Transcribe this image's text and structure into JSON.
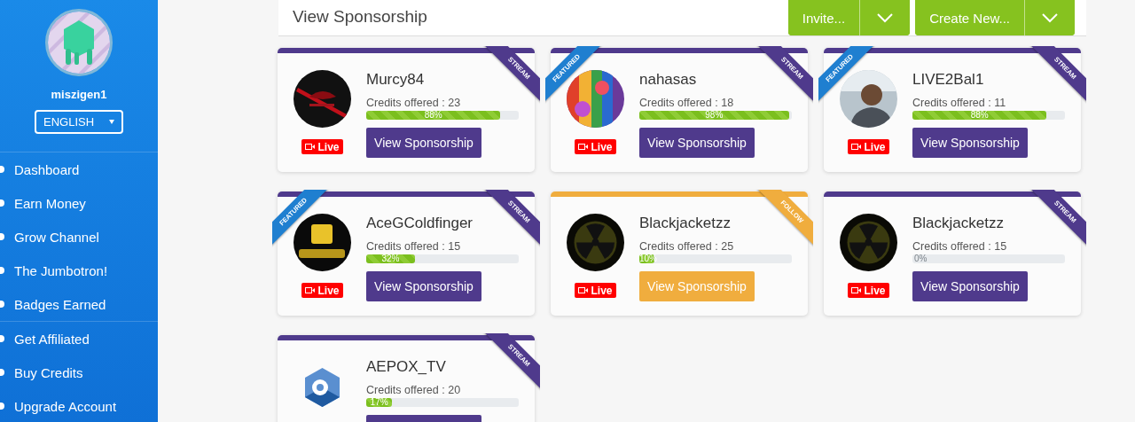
{
  "sidebar": {
    "username": "miszigen1",
    "language": "ENGLISH",
    "nav_groups": [
      [
        "Dashboard",
        "Earn Money",
        "Grow Channel",
        "The Jumbotron!",
        "Badges Earned"
      ],
      [
        "Get Affiliated",
        "Buy Credits",
        "Upgrade Account"
      ]
    ]
  },
  "header": {
    "title": "View Sponsorship",
    "buttons": [
      {
        "label": "Invite..."
      },
      {
        "label": "Create New..."
      }
    ]
  },
  "cards": [
    {
      "name": "Murcy84",
      "credits": "Credits offered : 23",
      "level": 0.88,
      "percent": "88%",
      "ribbon": "STREAM",
      "color": "#4f3a8c",
      "live_label": "Live",
      "button": "View Sponsorship"
    },
    {
      "name": "nahasas",
      "credits": "Credits offered : 18",
      "level": 0.98,
      "percent": "98%",
      "ribbon": "STREAM",
      "featured_label": "FEATURED",
      "color": "#4f3a8c",
      "live_label": "Live",
      "button": "View Sponsorship"
    },
    {
      "name": "LIVE2Bal1",
      "credits": "Credits offered : 11",
      "level": 0.88,
      "percent": "88%",
      "ribbon": "STREAM",
      "featured_label": "FEATURED",
      "color": "#4f3a8c",
      "live_label": "Live",
      "button": "View Sponsorship"
    },
    {
      "name": "AceGColdfinger",
      "credits": "Credits offered : 15",
      "level": 0.32,
      "percent": "32%",
      "ribbon": "STREAM",
      "featured_label": "FEATURED",
      "color": "#4f3a8c",
      "live_label": "Live",
      "button": "View Sponsorship"
    },
    {
      "name": "Blackjacketzz",
      "credits": "Credits offered : 25",
      "level": 0.1,
      "percent": "10%",
      "ribbon": "FOLLOW",
      "color": "#f0ad3e",
      "live_label": "Live",
      "button": "View Sponsorship"
    },
    {
      "name": "Blackjacketzz",
      "credits": "Credits offered : 15",
      "level": 0,
      "percent": "0%",
      "ribbon": "STREAM",
      "color": "#4f3a8c",
      "live_label": "Live",
      "button": "View Sponsorship"
    },
    {
      "name": "AEPOX_TV",
      "credits": "Credits offered : 20",
      "level": 0.17,
      "percent": "17%",
      "ribbon": "STREAM",
      "color": "#4f3a8c"
    }
  ]
}
